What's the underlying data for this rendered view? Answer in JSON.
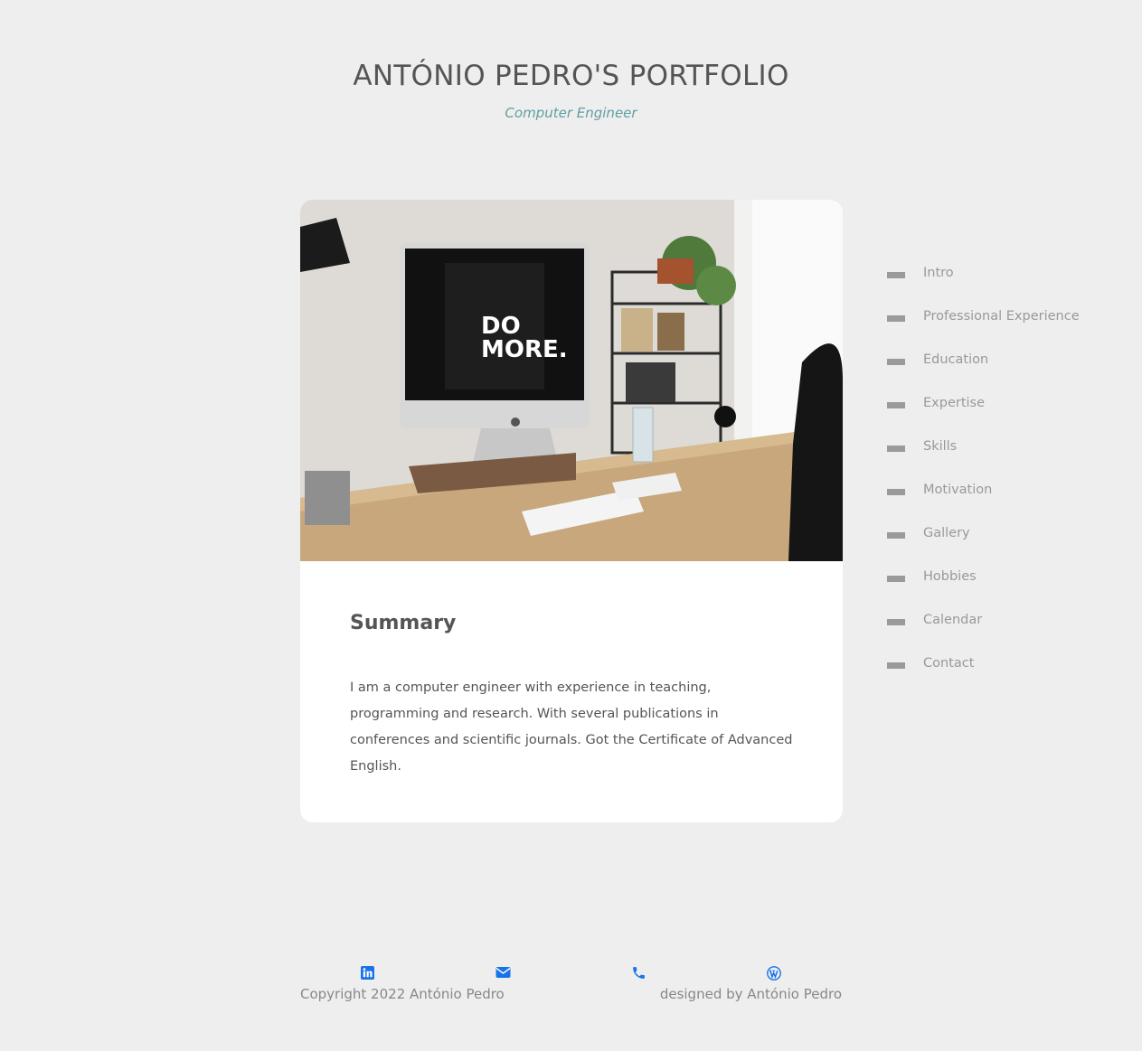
{
  "header": {
    "title": "ANTÓNIO PEDRO'S PORTFOLIO",
    "subtitle": "Computer Engineer"
  },
  "card": {
    "image_text_line1": "DO",
    "image_text_line2": "MORE.",
    "title": "Summary",
    "text": "I am a computer engineer with experience in teaching, programming and research. With several publications in conferences and scientific journals. Got the Certificate of Advanced English."
  },
  "nav": {
    "items": [
      {
        "label": "Intro"
      },
      {
        "label": "Professional Experience"
      },
      {
        "label": "Education"
      },
      {
        "label": "Expertise"
      },
      {
        "label": "Skills"
      },
      {
        "label": "Motivation"
      },
      {
        "label": "Gallery"
      },
      {
        "label": "Hobbies"
      },
      {
        "label": "Calendar"
      },
      {
        "label": "Contact"
      }
    ]
  },
  "footer": {
    "copyright": "Copyright 2022 António Pedro",
    "designed_by": "designed by António Pedro",
    "icons": [
      "linkedin-icon",
      "email-icon",
      "phone-icon",
      "wordpress-icon"
    ],
    "icon_color": "#1a73e8"
  },
  "colors": {
    "background": "#eeeeee",
    "card": "#ffffff",
    "title": "#555555",
    "subtitle": "#5f9fa0",
    "nav_text": "#999999",
    "nav_dash": "#9a9a9a"
  }
}
